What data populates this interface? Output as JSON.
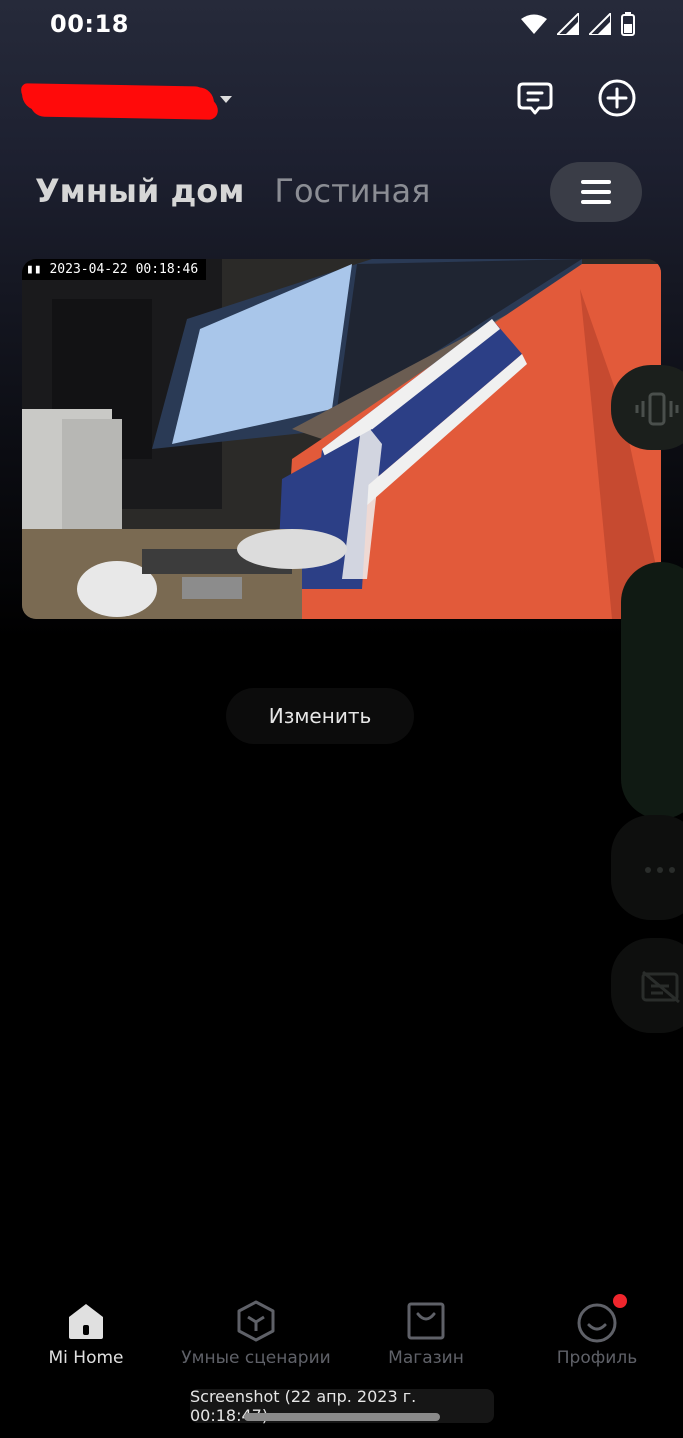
{
  "status_bar": {
    "time": "00:18"
  },
  "header": {
    "home_name_redacted": true
  },
  "tabs": [
    {
      "label": "Умный дом",
      "active": true
    },
    {
      "label": "Гостиная",
      "active": false
    }
  ],
  "camera": {
    "timestamp": "2023-04-22 00:18:46"
  },
  "edit_label": "Изменить",
  "bottom_nav": [
    {
      "label": "Mi Home",
      "icon": "home-icon",
      "active": true
    },
    {
      "label": "Умные сценарии",
      "icon": "scenario-cube-icon",
      "active": false
    },
    {
      "label": "Магазин",
      "icon": "shop-bag-icon",
      "active": false
    },
    {
      "label": "Профиль",
      "icon": "profile-smile-icon",
      "active": false,
      "badge": true
    }
  ],
  "toast": "Screenshot (22 апр. 2023 г. 00:18:47)",
  "colors": {
    "accent_red": "#f0262d",
    "card_bg": "#3a3d47"
  }
}
